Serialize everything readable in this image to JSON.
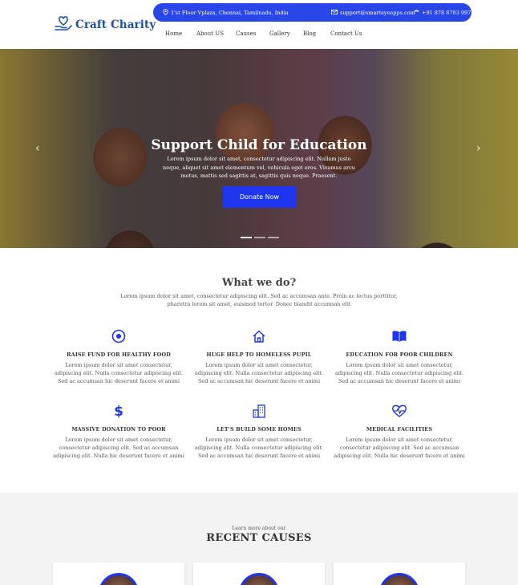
{
  "brand": {
    "name": "Craft Charity",
    "color": "#1f4fa8"
  },
  "topbar": {
    "address": "1'st Floor Vplaza, Chennai, Tamilnadu, India",
    "email": "support@smarteyeapps.com",
    "phone": "+91 878 8783 997",
    "color": "#2946e8"
  },
  "nav": [
    "Home",
    "About US",
    "Causes",
    "Gallery",
    "Blog",
    "Contact Us"
  ],
  "hero": {
    "title": "Support Child for Education",
    "text": "Lorem ipsum dolor sit amet, consectetur adipiscing elit. Nullam justo neque, aliquet sit amet elementum vel, vehicula eget eros. Vivamus arcu metus, mattis sed sagittis at, sagittis quis neque. Praesent.",
    "button": "Donate Now",
    "prev_icon": "chevron-left-icon",
    "next_icon": "chevron-right-icon",
    "slides": 3,
    "active_slide": 1
  },
  "what_we_do": {
    "title": "What we do?",
    "subtitle": "Lorem ipsum dolor sit amet, consectetur adipiscing elit. Sed ac accumsan ante. Proin ac lectus porttitor, pharetra lorem sit amet, euismod tortor. Donec blandit accumsan elit",
    "features": [
      {
        "icon": "target-icon",
        "title": "RAISE FUND FOR HEALTHY FOOD",
        "text": "Lorem ipsum dolor sit amet consectetur, adipiscing elit. Nulla consectetur adipiscing elit. Sed ac accumsan hic deserunt facere et animi"
      },
      {
        "icon": "home-icon",
        "title": "HUGE HELP TO HOMELESS PUPIL",
        "text": "Lorem ipsum dolor sit amet consectetur, adipiscing elit. Nulla consectetur adipiscing elit. Sed ac accumsan hic deserunt facere et animi"
      },
      {
        "icon": "book-icon",
        "title": "EDUCATION FOR POOR CHILDREN",
        "text": "Lorem ipsum dolor sit amet consectetur, adipiscing elit. Nulla consectetur adipiscing elit. Sed ac accumsan hic deserunt facere et animi"
      },
      {
        "icon": "dollar-icon",
        "title": "MASSIVE DONATION TO POOR",
        "text": "Lorem ipsum dolor sit amet consectetur, consectetur adipiscing elit. Sed ac accumsan adipiscing elit. Nulla hic deserunt facere et animi"
      },
      {
        "icon": "buildings-icon",
        "title": "LET'S BUILD SOME HOMES",
        "text": "Lorem ipsum dolor sit amet consectetur, adipiscing elit. Nulla consectetur adipiscing elit. Sed ac accumsan hic deserunt facere et animi"
      },
      {
        "icon": "heartbeat-icon",
        "title": "MEDICAL FACILITIES",
        "text": "Lorem ipsum dolor sit amet consectetur, consectetur adipiscing elit. Sed ac accumsan adipiscing elit. Nulla hic deserunt facere et animi"
      }
    ]
  },
  "causes": {
    "kicker": "Learn more about our",
    "title": "RECENT CAUSES"
  },
  "accent": "#1f35ee"
}
